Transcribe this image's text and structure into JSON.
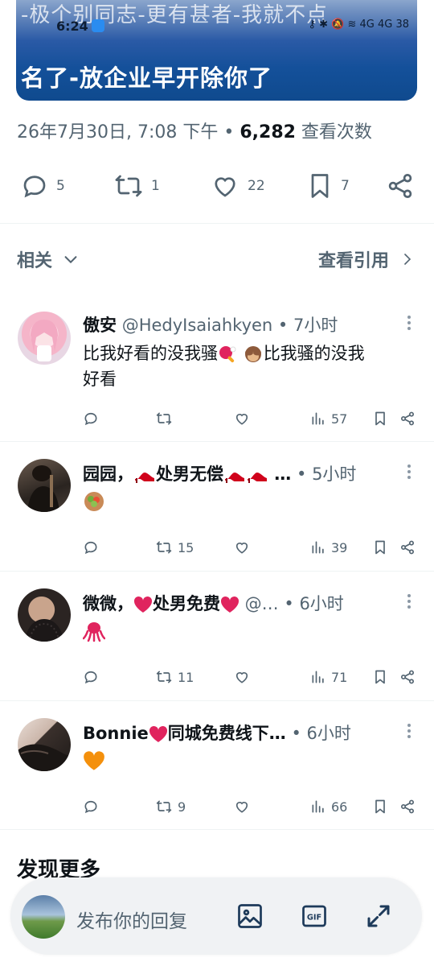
{
  "media": {
    "ghost_text": "-极个别同志-更有甚者-我就不点",
    "caption": "名了-放企业早开除你了",
    "status_time": "6:24",
    "status_icons": "⚷ ✱ 🔕 ≋ 4G 4G 38"
  },
  "post_meta": {
    "datetime": "26年7月30日, 7:08 下午",
    "sep": " • ",
    "views_count": "6,282",
    "views_label": " 查看次数"
  },
  "post_actions": {
    "replies": "5",
    "reposts": "1",
    "likes": "22",
    "bookmarks": "7"
  },
  "related": {
    "label": "相关",
    "quotes_label": "查看引用"
  },
  "replies": [
    {
      "name": "傲安",
      "handle": "@HedyIsaiahkyen",
      "sep": " • ",
      "time": "7小时",
      "text_line1": "比我好看的没我骚",
      "text_mid": "比我骚的没我",
      "text_line2": "好看",
      "reply_count": "",
      "repost_count": "",
      "views": "57"
    },
    {
      "name": "园园，",
      "name2": "处男无偿",
      "ellipsis": " …",
      "sep": " • ",
      "time": "5小时",
      "reply_count": "",
      "repost_count": "15",
      "views": "39"
    },
    {
      "name": "微微，",
      "name2": "处男免费",
      "handle": " @…",
      "sep": " • ",
      "time": "6小时",
      "reply_count": "",
      "repost_count": "11",
      "views": "71"
    },
    {
      "name": "Bonnie",
      "name2": "同城免费线下…",
      "sep": " • ",
      "time": "6小时",
      "reply_count": "",
      "repost_count": "9",
      "views": "66"
    }
  ],
  "discover": {
    "title": "发现更多"
  },
  "composer": {
    "placeholder": "发布你的回复"
  },
  "colors": {
    "text": "#0f1419",
    "muted": "#536471",
    "divider": "#eff3f4",
    "heart_red": "#e0245e"
  },
  "icons": [
    "reply-icon",
    "repost-icon",
    "like-icon",
    "bookmark-icon",
    "share-icon",
    "views-icon",
    "chevron-down-icon",
    "chevron-right-icon",
    "more-icon",
    "image-icon",
    "gif-icon",
    "expand-icon"
  ]
}
